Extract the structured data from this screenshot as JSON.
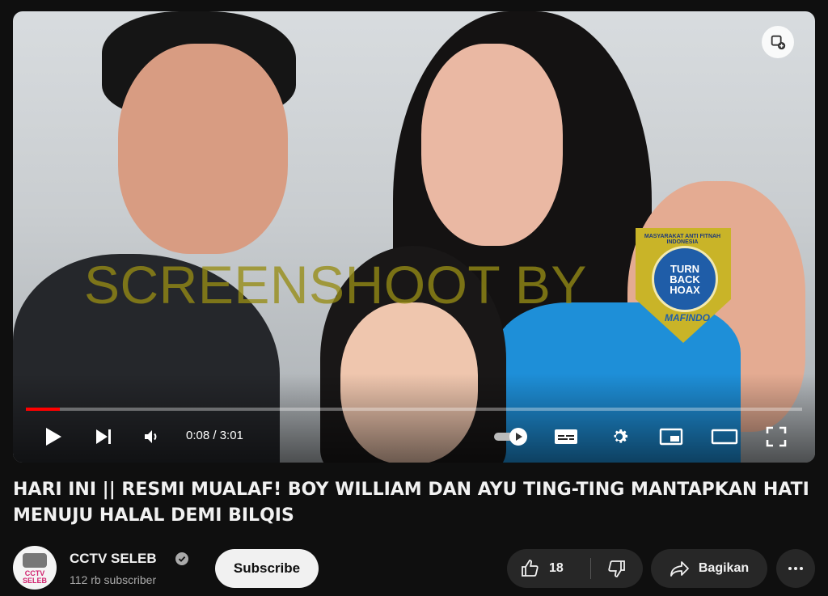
{
  "video": {
    "watermark_text": "SCREENSHOOT BY",
    "badge": {
      "arc_text": "MASYARAKAT ANTI FITNAH INDONESIA",
      "line1": "TURN",
      "line2": "BACK",
      "line3": "HOAX",
      "bottom_text": "MAFINDO"
    },
    "progress_fraction": 0.044,
    "time_display": "0:08 / 3:01",
    "colors": {
      "progress": "#ff0000",
      "badge": "#c9b428",
      "badge_circle": "#1f5da8"
    },
    "controls": [
      "play-icon",
      "next-icon",
      "volume-icon",
      "autoplay-toggle-icon",
      "subtitles-icon",
      "settings-gear-icon",
      "miniplayer-icon",
      "theater-mode-icon",
      "fullscreen-icon"
    ]
  },
  "title": "HARI INI || RESMI MUALAF! BOY WILLIAM DAN AYU TING-TING MANTAPKAN HATI MENUJU HALAL DEMI BILQIS",
  "channel": {
    "name": "CCTV SELEB",
    "avatar_text": "CCTV SELEB",
    "subscribers": "112 rb subscriber",
    "subscribe_label": "Subscribe"
  },
  "actions": {
    "like_count": "18",
    "share_label": "Bagikan"
  }
}
